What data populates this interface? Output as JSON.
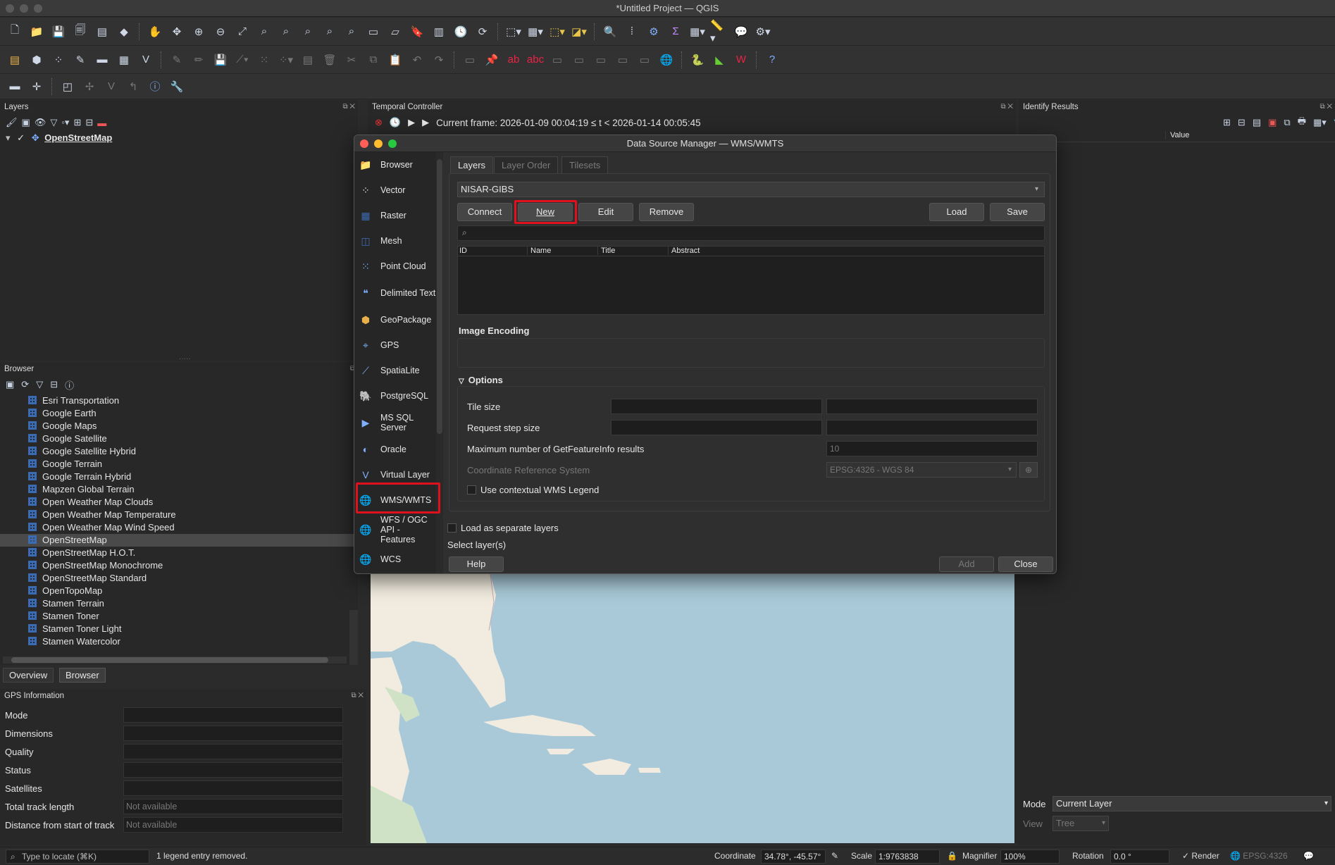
{
  "window": {
    "title": "*Untitled Project — QGIS"
  },
  "layers_panel": {
    "title": "Layers",
    "layer_name": "OpenStreetMap"
  },
  "temporal": {
    "title": "Temporal Controller",
    "frame_text": "Current frame: 2026-01-09 00:04:19 ≤ t < 2026-01-14 00:05:45"
  },
  "identify": {
    "title": "Identify Results",
    "value_header": "Value",
    "mode_label": "Mode",
    "mode_value": "Current Layer",
    "view_label": "View",
    "view_value": "Tree"
  },
  "browser": {
    "title": "Browser",
    "items": [
      "Esri Transportation",
      "Google Earth",
      "Google Maps",
      "Google Satellite",
      "Google Satellite Hybrid",
      "Google Terrain",
      "Google Terrain Hybrid",
      "Mapzen Global Terrain",
      "Open Weather Map Clouds",
      "Open Weather Map Temperature",
      "Open Weather Map Wind Speed",
      "OpenStreetMap",
      "OpenStreetMap H.O.T.",
      "OpenStreetMap Monochrome",
      "OpenStreetMap Standard",
      "OpenTopoMap",
      "Stamen Terrain",
      "Stamen Toner",
      "Stamen Toner Light",
      "Stamen Watercolor"
    ],
    "selected": "OpenStreetMap"
  },
  "bottom_tabs": {
    "overview": "Overview",
    "browser": "Browser"
  },
  "gps": {
    "title": "GPS Information",
    "rows": [
      {
        "label": "Mode",
        "value": ""
      },
      {
        "label": "Dimensions",
        "value": ""
      },
      {
        "label": "Quality",
        "value": ""
      },
      {
        "label": "Status",
        "value": ""
      },
      {
        "label": "Satellites",
        "value": ""
      },
      {
        "label": "Total track length",
        "value": "Not available"
      },
      {
        "label": "Distance from start of track",
        "value": "Not available"
      }
    ]
  },
  "dialog": {
    "title": "Data Source Manager — WMS/WMTS",
    "sidebar": [
      "Browser",
      "Vector",
      "Raster",
      "Mesh",
      "Point Cloud",
      "Delimited Text",
      "GeoPackage",
      "GPS",
      "SpatiaLite",
      "PostgreSQL",
      "MS SQL Server",
      "Oracle",
      "Virtual Layer",
      "WMS/WMTS",
      "WFS / OGC API - Features",
      "WCS"
    ],
    "tabs": [
      "Layers",
      "Layer Order",
      "Tilesets"
    ],
    "connection": "NISAR-GIBS",
    "buttons": {
      "connect": "Connect",
      "new": "New",
      "edit": "Edit",
      "remove": "Remove",
      "load": "Load",
      "save": "Save"
    },
    "columns": [
      "ID",
      "Name",
      "Title",
      "Abstract"
    ],
    "image_encoding": "Image Encoding",
    "options": "Options",
    "tile_size": "Tile size",
    "request_step": "Request step size",
    "max_getfeatureinfo": "Maximum number of GetFeatureInfo results",
    "max_getfeatureinfo_value": "10",
    "crs_label": "Coordinate Reference System",
    "crs_value": "EPSG:4326 - WGS 84",
    "contextual_legend": "Use contextual WMS Legend",
    "separate_layers": "Load as separate layers",
    "select_layers": "Select layer(s)",
    "help": "Help",
    "add": "Add",
    "close": "Close"
  },
  "status": {
    "locate_placeholder": "Type to locate (⌘K)",
    "message": "1 legend entry removed.",
    "coordinate_label": "Coordinate",
    "coordinate_value": "34.78°, -45.57°",
    "scale_label": "Scale",
    "scale_value": "1:9763838",
    "magnifier_label": "Magnifier",
    "magnifier_value": "100%",
    "rotation_label": "Rotation",
    "rotation_value": "0.0 °",
    "render_label": "Render",
    "crs": "EPSG:4326"
  }
}
